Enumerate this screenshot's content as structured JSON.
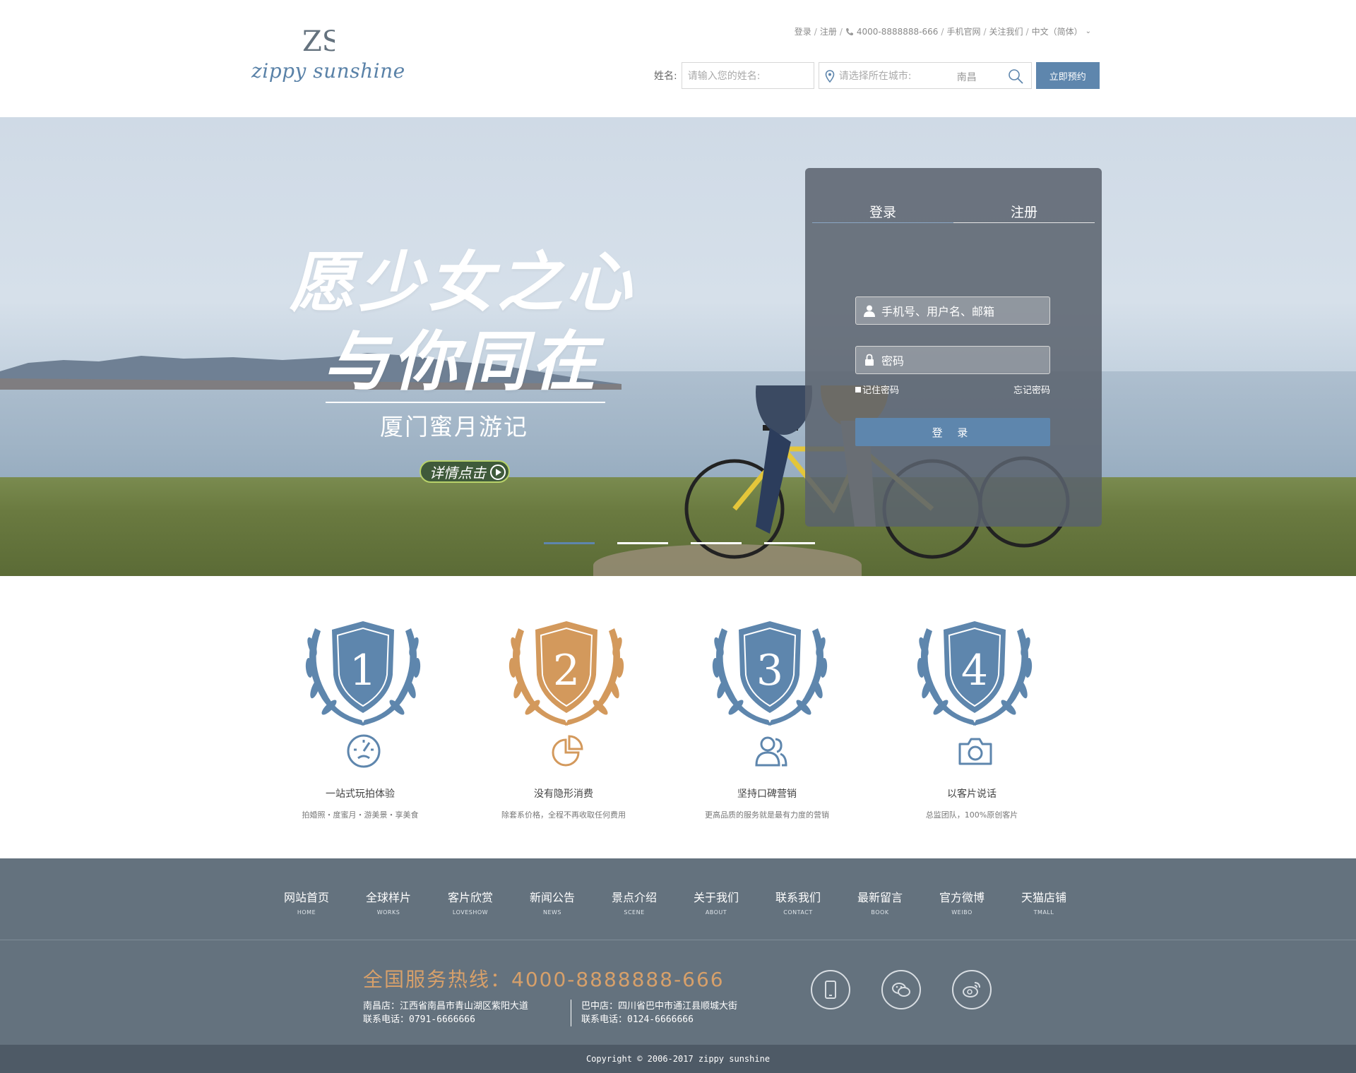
{
  "header": {
    "logo_mark": "ZS",
    "logo_text": "zippy sunshine",
    "toplinks": {
      "login": "登录",
      "register": "注册",
      "phone": "4000-8888888-666",
      "mobile": "手机官网",
      "follow": "关注我们",
      "language": "中文（简体）"
    },
    "booking": {
      "name_label": "姓名:",
      "name_placeholder": "请输入您的姓名:",
      "city_placeholder": "请选择所在城市:",
      "city_value": "南昌",
      "submit": "立即预约"
    }
  },
  "hero": {
    "slogan_line1": "愿少女之心",
    "slogan_line2": "与你同在",
    "subtitle": "厦门蜜月游记",
    "button": "详情点击",
    "slides": 4,
    "active_slide": 1
  },
  "login_panel": {
    "tab_login": "登录",
    "tab_register": "注册",
    "account_placeholder": "手机号、用户名、邮箱",
    "password_placeholder": "密码",
    "remember": "记住密码",
    "forget": "忘记密码",
    "submit": "登 录"
  },
  "features": [
    {
      "number": "1",
      "title": "一站式玩拍体验",
      "subtitle": "拍婚照・度蜜月・游美景・享美食",
      "color": "#5e86ad",
      "icon": "speedometer-icon"
    },
    {
      "number": "2",
      "title": "没有隐形消费",
      "subtitle": "除套系价格，全程不再收取任何费用",
      "color": "#d3995c",
      "icon": "pie-chart-icon"
    },
    {
      "number": "3",
      "title": "坚持口碑营销",
      "subtitle": "更高品质的服务就是最有力度的营销",
      "color": "#5e86ad",
      "icon": "users-icon"
    },
    {
      "number": "4",
      "title": "以客片说话",
      "subtitle": "总监团队，100%原创客片",
      "color": "#5e86ad",
      "icon": "camera-icon"
    }
  ],
  "footer_nav": [
    {
      "zh": "网站首页",
      "en": "HOME"
    },
    {
      "zh": "全球样片",
      "en": "WORKS"
    },
    {
      "zh": "客片欣赏",
      "en": "LOVESHOW"
    },
    {
      "zh": "新闻公告",
      "en": "NEWS"
    },
    {
      "zh": "景点介绍",
      "en": "SCENE"
    },
    {
      "zh": "关于我们",
      "en": "ABOUT"
    },
    {
      "zh": "联系我们",
      "en": "CONTACT"
    },
    {
      "zh": "最新留言",
      "en": "BOOK"
    },
    {
      "zh": "官方微博",
      "en": "WEIBO"
    },
    {
      "zh": "天猫店铺",
      "en": "TMALL"
    }
  ],
  "footer_info": {
    "hotline": "全国服务热线：4000-8888888-666",
    "store1_address": "南昌店：江西省南昌市青山湖区紫阳大道",
    "store1_phone": "联系电话：0791-6666666",
    "store2_address": "巴中店：四川省巴中市通江县顺城大街",
    "store2_phone": "联系电话：0124-6666666",
    "social": [
      "mobile-icon",
      "wechat-icon",
      "weibo-icon"
    ]
  },
  "copyright": "Copyright © 2006-2017 zippy sunshine",
  "colors": {
    "accent": "#5e86ad",
    "gold": "#d3995c",
    "footer": "#64727e",
    "copyright_bar": "#4e5a66"
  }
}
